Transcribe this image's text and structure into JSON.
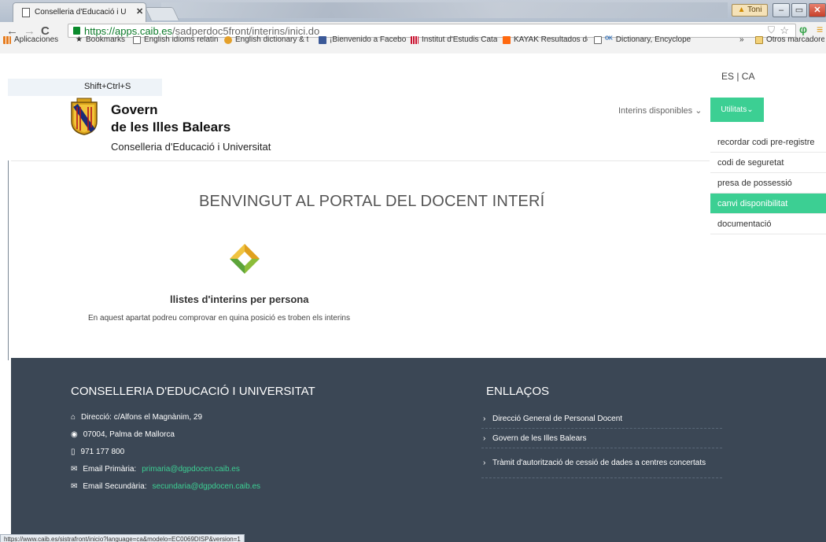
{
  "browser": {
    "tab_title": "Conselleria d'Educació i U",
    "user_badge": "Toni",
    "url_host": "https://apps.caib.es",
    "url_path": "/sadperdoc5front/interins/inici.do",
    "bookmarks": [
      {
        "label": "Aplicaciones",
        "icon": "apps-grid-icon",
        "color": "#e57c1f"
      },
      {
        "label": "Bookmarks",
        "icon": "star-icon",
        "color": "#444444"
      },
      {
        "label": "English idioms relatin",
        "icon": "page-icon",
        "color": "#ffffff"
      },
      {
        "label": "English dictionary & t",
        "icon": "dictionary-icon",
        "color": "#4c9c2e"
      },
      {
        "label": "¡Bienvenido a Facebo",
        "icon": "facebook-icon",
        "color": "#3b5998"
      },
      {
        "label": "Institut d'Estudis Cata",
        "icon": "iec-icon",
        "color": "#c8102e"
      },
      {
        "label": "KAYAK Resultados de",
        "icon": "kayak-icon",
        "color": "#ff690f"
      },
      {
        "label": "Dictionary, Encyclope",
        "icon": "thefreedictionary-icon",
        "color": "#2f6db5"
      }
    ],
    "bookmarks_overflow": "»",
    "other_bookmarks": "Otros marcadores",
    "status_url": "https://www.caib.es/sistrafront/inicio?language=ca&modelo=EC0069DISP&version=1"
  },
  "header": {
    "langs": "ES | CA",
    "tooltip": "Shift+Ctrl+S",
    "brand_line1": "Govern",
    "brand_line2": "de les Illes Balears",
    "brand_line3": "Conselleria d'Educació i Universitat",
    "nav_interins": "Interins disponibles",
    "utilitats": "Utilitats",
    "accent": "#3ccf93",
    "dropdown": [
      {
        "label": "recordar codi pre-registre",
        "active": false
      },
      {
        "label": "codi de seguretat",
        "active": false
      },
      {
        "label": "presa de possessió",
        "active": false
      },
      {
        "label": "canvi disponibilitat",
        "active": true
      },
      {
        "label": "documentació",
        "active": false
      }
    ]
  },
  "main": {
    "welcome": "BENVINGUT AL PORTAL DEL DOCENT INTERÍ",
    "section_title": "llistes d'interins per persona",
    "section_desc": "En aquest apartat podreu comprovar en quina posició es troben els interins"
  },
  "footer": {
    "title": "CONSELLERIA D'EDUCACIÓ I UNIVERSITAT",
    "address": "Direcció: c/Alfons el Magnànim, 29",
    "city": "07004, Palma de Mallorca",
    "phone": "971 177 800",
    "email_primaria_label": "Email Primària:",
    "email_primaria": "primaria@dgpdocen.caib.es",
    "email_secundaria_label": "Email Secundària:",
    "email_secundaria": "secundaria@dgpdocen.caib.es",
    "links_title": "ENLLAÇOS",
    "links": [
      "Direcció General de Personal Docent",
      "Govern de les Illes Balears",
      "Tràmit d'autorització de cessió de dades a centres concertats"
    ],
    "bg": "#3b4755"
  }
}
